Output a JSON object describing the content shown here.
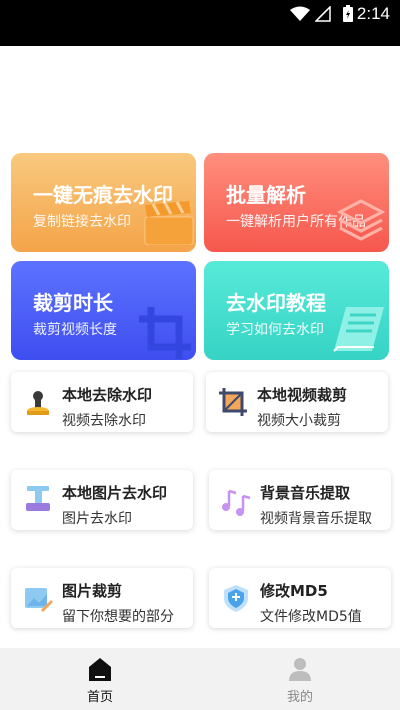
{
  "status_bar": {
    "time": "2:14"
  },
  "feature_tiles": [
    {
      "title": "一键无痕去水印",
      "subtitle": "复制链接去水印",
      "icon": "film-clapper-icon"
    },
    {
      "title": "批量解析",
      "subtitle": "一键解析用户所有作品",
      "icon": "layers-icon"
    },
    {
      "title": "裁剪时长",
      "subtitle": "裁剪视频长度",
      "icon": "crop-icon"
    },
    {
      "title": "去水印教程",
      "subtitle": "学习如何去水印",
      "icon": "book-icon"
    }
  ],
  "tool_cards": [
    {
      "title": "本地去除水印",
      "subtitle": "视频去除水印",
      "icon": "stamp-icon"
    },
    {
      "title": "本地视频裁剪",
      "subtitle": "视频大小裁剪",
      "icon": "crop-frame-icon"
    },
    {
      "title": "本地图片去水印",
      "subtitle": "图片去水印",
      "icon": "image-stamp-icon"
    },
    {
      "title": "背景音乐提取",
      "subtitle": "视频背景音乐提取",
      "icon": "music-note-icon"
    },
    {
      "title": "图片裁剪",
      "subtitle": "留下你想要的部分",
      "icon": "image-edit-icon"
    },
    {
      "title": "修改MD5",
      "subtitle": "文件修改MD5值",
      "icon": "shield-icon"
    }
  ],
  "tab_bar": {
    "tabs": [
      {
        "label": "首页",
        "icon": "home-icon",
        "active": true
      },
      {
        "label": "我的",
        "icon": "user-icon",
        "active": false
      }
    ]
  },
  "colors": {
    "active_tab": "#111111",
    "inactive_tab": "#888888"
  }
}
